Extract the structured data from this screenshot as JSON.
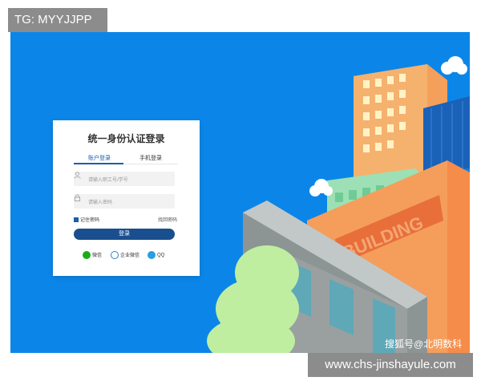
{
  "tag_badge": "TG: MYYJJPP",
  "login": {
    "title": "统一身份认证登录",
    "tabs": [
      {
        "label": "账户登录"
      },
      {
        "label": "手机登录"
      }
    ],
    "username_placeholder": "请输入职工号/学号",
    "password_placeholder": "请输入密码",
    "remember_label": "记住密码",
    "forgot_label": "找回密码",
    "submit_label": "登录",
    "social": [
      {
        "label": "微信",
        "icon": "wechat-icon"
      },
      {
        "label": "企业微信",
        "icon": "wework-icon"
      },
      {
        "label": "QQ",
        "icon": "qq-icon"
      }
    ]
  },
  "scene": {
    "building_sign": "BUILDING",
    "colors": {
      "sky": "#0b86e8",
      "tower": "#f5a05a",
      "mint": "#9ee0b5",
      "gray": "#9aa0a0",
      "tree": "#bfeea0",
      "accent_blue": "#1a4f8f"
    }
  },
  "watermark": "搜狐号@北明数科",
  "url_badge": "www.chs-jinshayule.com"
}
